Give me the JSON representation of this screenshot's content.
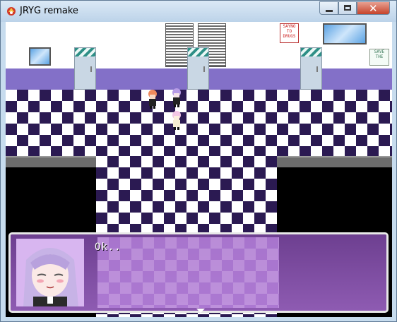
{
  "window": {
    "title": "JRYG remake",
    "app_icon": "app-icon"
  },
  "controls": {
    "minimize_icon": "minimize-icon",
    "maximize_icon": "maximize-icon",
    "close_icon": "close-icon",
    "close_glyph": "✕"
  },
  "scene": {
    "poster_text": "SAYNO TO DRUGS",
    "sign_text": "SAVE THE"
  },
  "dialog": {
    "text": "Ok..",
    "face_icon": "character-face-icon",
    "continue_icon": "continue-arrow-icon"
  },
  "colors": {
    "wall_stripe": "#8370c8",
    "floor_dark": "#2b1a52",
    "dialog_bg": "#8e5bb2"
  }
}
